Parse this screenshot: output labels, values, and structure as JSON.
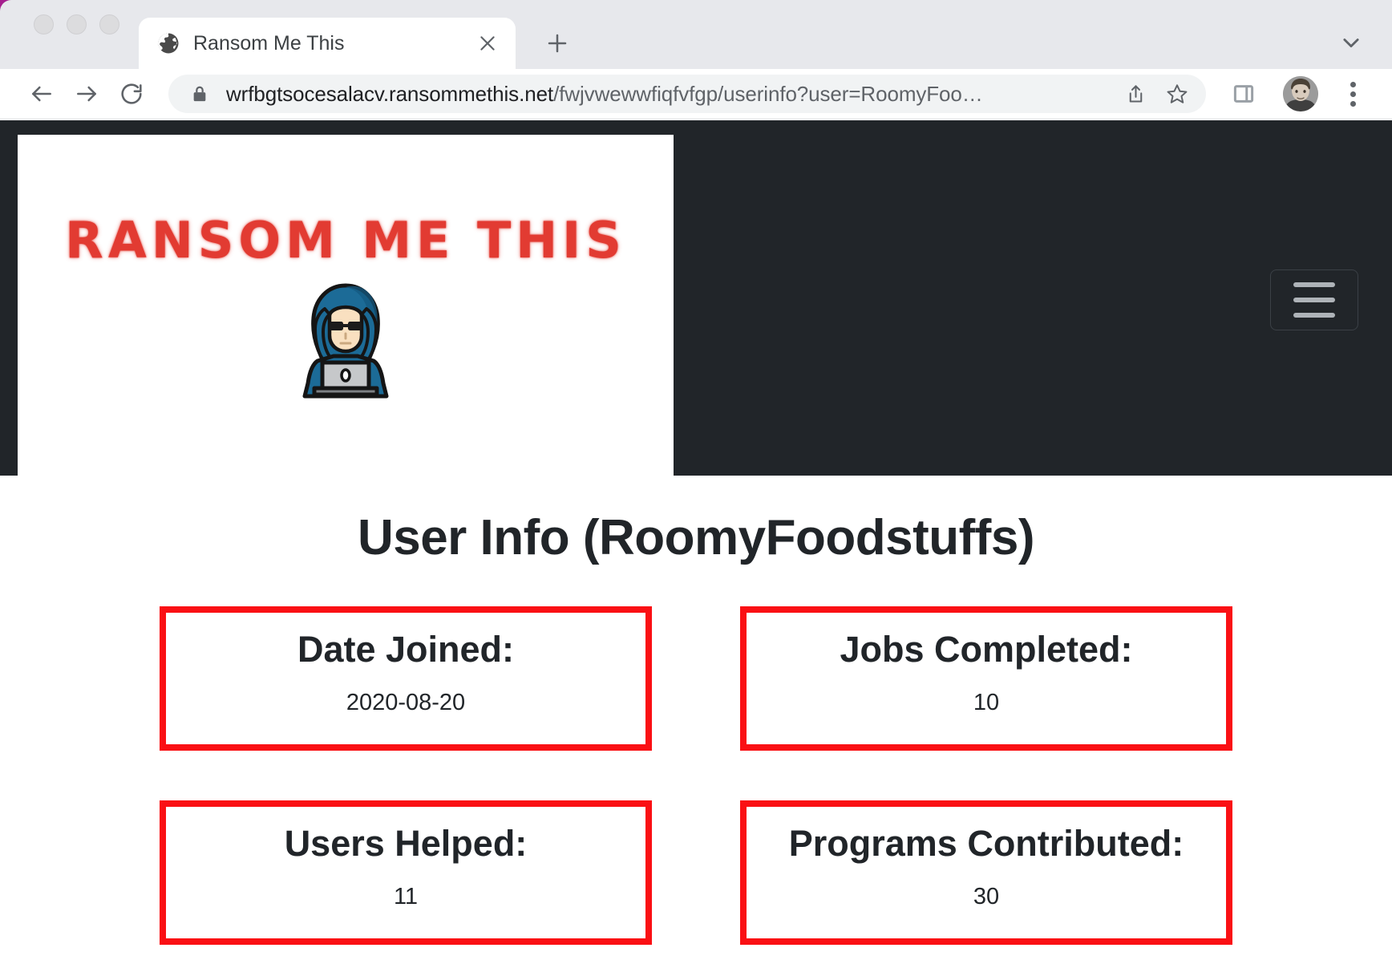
{
  "browser": {
    "window_controls": [
      "close",
      "minimize",
      "maximize"
    ],
    "tab": {
      "title": "Ransom Me This",
      "favicon": "globe-icon",
      "close_label": "×"
    },
    "new_tab_label": "+",
    "tab_search_icon": "chevron-down-icon",
    "toolbar": {
      "back_icon": "back-arrow-icon",
      "forward_icon": "forward-arrow-icon",
      "reload_icon": "reload-icon",
      "lock_icon": "lock-icon",
      "url_domain": "wrfbgtsocesalacv.ransommethis.net",
      "url_path": "/fwjvwewwfiqfvfgp/userinfo?user=RoomyFoo…",
      "url_full": "wrfbgtsocesalacv.ransommethis.net/fwjvwewwfiqfvfgp/userinfo?user=RoomyFoo…",
      "share_icon": "share-icon",
      "bookmark_icon": "star-icon",
      "side_panel_icon": "side-panel-icon",
      "profile_icon": "avatar",
      "menu_icon": "three-dot-menu-icon"
    }
  },
  "site": {
    "navbar": {
      "brand_text": "RANSOM ME THIS",
      "brand_emoji": "hacker-emoji",
      "menu_toggle_label": "Toggle navigation",
      "background_color": "#212529"
    },
    "page_title": "User Info (RoomyFoodstuffs)",
    "username": "RoomyFoodstuffs",
    "accent_color": "#fa1014",
    "cards": [
      {
        "label": "Date Joined:",
        "value": "2020-08-20"
      },
      {
        "label": "Jobs Completed:",
        "value": "10"
      },
      {
        "label": "Users Helped:",
        "value": "11"
      },
      {
        "label": "Programs Contributed:",
        "value": "30"
      }
    ]
  }
}
